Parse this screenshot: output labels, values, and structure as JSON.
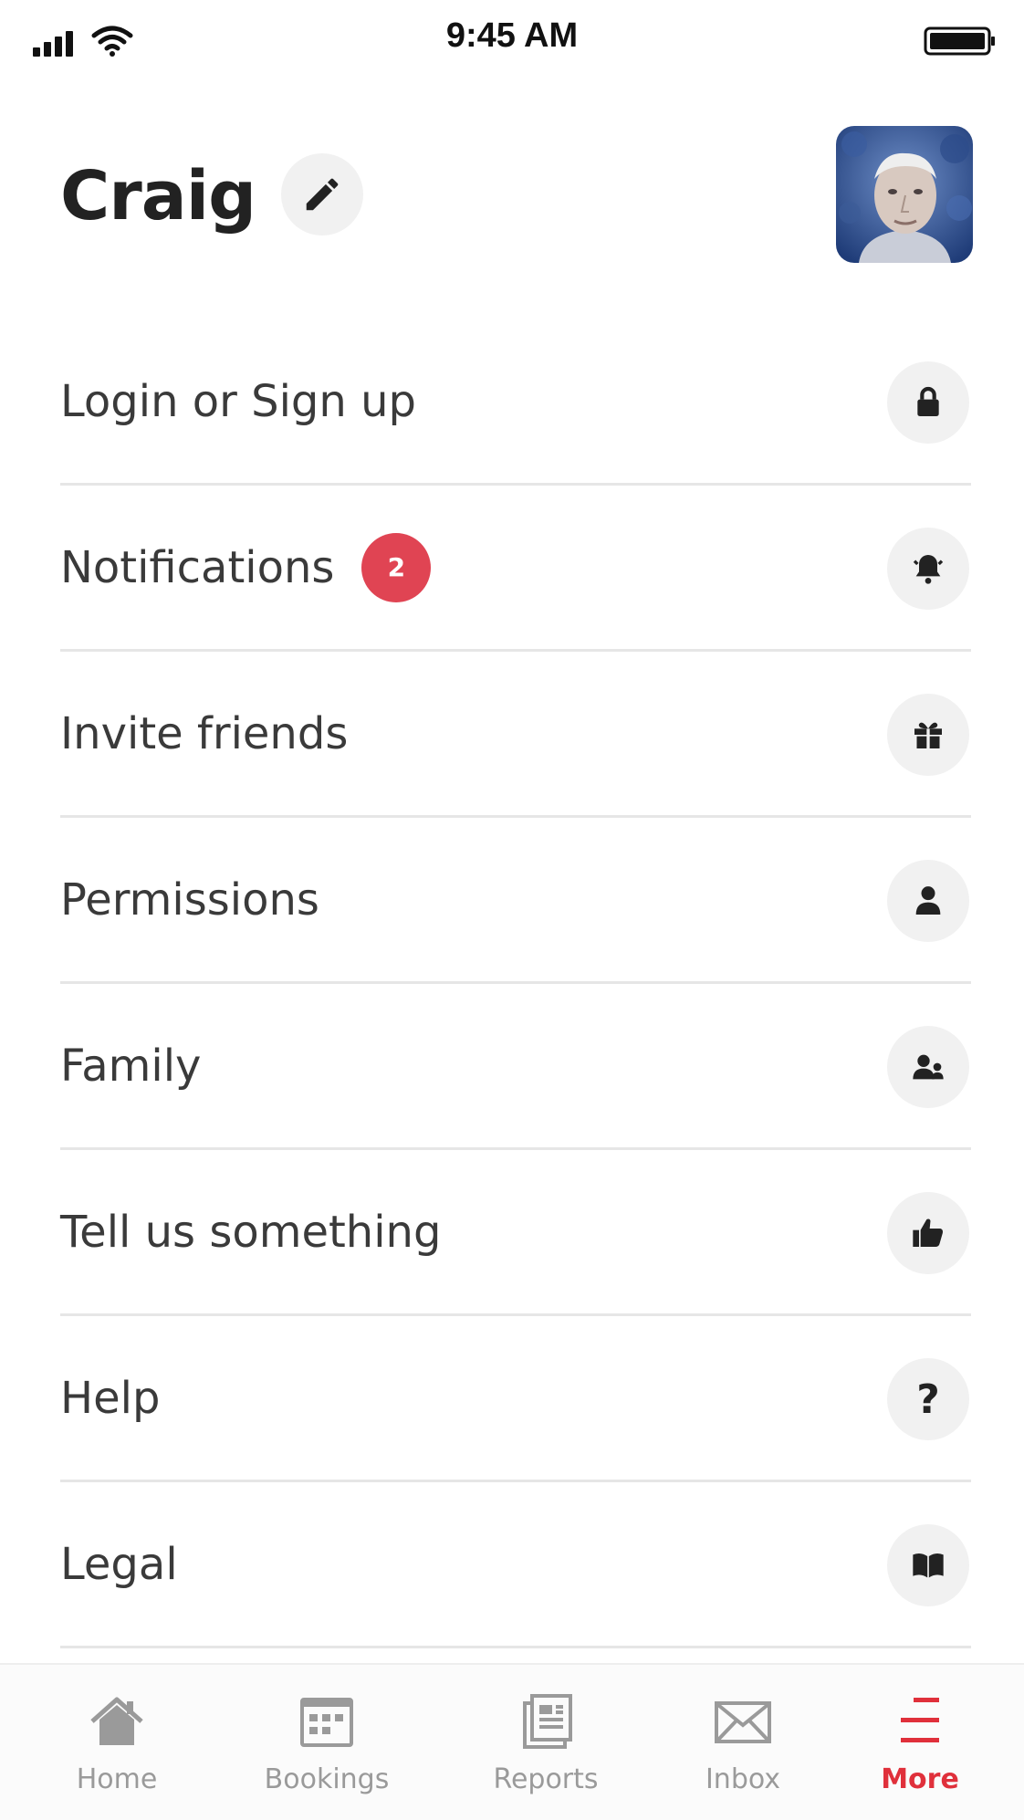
{
  "status_bar": {
    "time": "9:45 AM"
  },
  "profile": {
    "name": "Craig"
  },
  "menu": {
    "items": [
      {
        "label": "Login or Sign up",
        "icon": "lock-icon"
      },
      {
        "label": "Notifications",
        "icon": "bell-icon",
        "badge": "2"
      },
      {
        "label": "Invite friends",
        "icon": "gift-icon"
      },
      {
        "label": "Permissions",
        "icon": "user-icon"
      },
      {
        "label": "Family",
        "icon": "users-icon"
      },
      {
        "label": "Tell us something",
        "icon": "thumbs-up-icon"
      },
      {
        "label": "Help",
        "icon": "question-icon",
        "glyph": "?"
      },
      {
        "label": "Legal",
        "icon": "book-icon"
      }
    ]
  },
  "tab_bar": {
    "tabs": [
      {
        "label": "Home",
        "icon": "home-icon"
      },
      {
        "label": "Bookings",
        "icon": "calendar-icon"
      },
      {
        "label": "Reports",
        "icon": "report-icon"
      },
      {
        "label": "Inbox",
        "icon": "envelope-icon"
      },
      {
        "label": "More",
        "icon": "menu-icon",
        "active": true
      }
    ]
  },
  "colors": {
    "accent": "#e0303b",
    "badge": "#e04453",
    "icon_bg": "#f1f1f1",
    "divider": "#e6e6e6"
  }
}
